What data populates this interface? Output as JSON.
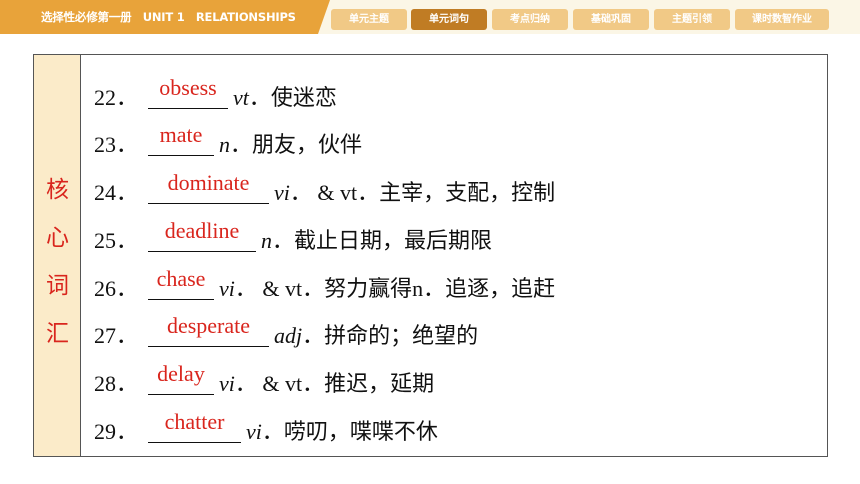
{
  "header": {
    "book_title": "选择性必修第一册　UNIT 1　RELATIONSHIPS",
    "tabs": [
      {
        "label": "单元主题",
        "active": false
      },
      {
        "label": "单元词句",
        "active": true
      },
      {
        "label": "考点归纳",
        "active": false
      },
      {
        "label": "基础巩固",
        "active": false
      },
      {
        "label": "主题引领",
        "active": false
      },
      {
        "label": "课时数智作业",
        "active": false
      }
    ]
  },
  "side_label": [
    "核",
    "心",
    "词",
    "汇"
  ],
  "vocab": [
    {
      "num": "22．",
      "answer": "obsess",
      "pos": "vt",
      "meaning": "．使迷恋"
    },
    {
      "num": "23．",
      "answer": "mate",
      "pos": "n",
      "meaning": "．朋友，伙伴"
    },
    {
      "num": "24．",
      "answer": "dominate",
      "pos": "vi",
      "meaning": "． & vt．主宰，支配，控制"
    },
    {
      "num": "25．",
      "answer": "deadline",
      "pos": "n",
      "meaning": "．截止日期，最后期限"
    },
    {
      "num": "26．",
      "answer": "chase",
      "pos": "vi",
      "meaning": "． & vt．努力赢得n．追逐，追赶"
    },
    {
      "num": "27．",
      "answer": "desperate",
      "pos": "adj",
      "meaning": "．拼命的；绝望的"
    },
    {
      "num": "28．",
      "answer": "delay",
      "pos": "vi",
      "meaning": "． & vt．推迟，延期"
    },
    {
      "num": "29．",
      "answer": "chatter",
      "pos": "vi",
      "meaning": "．唠叨，喋喋不休"
    }
  ],
  "colors": {
    "accent": "#e8a33a",
    "tab": "#f1c986",
    "tab_active": "#c07c24",
    "answer": "#d9251d",
    "side_bg": "#fbebc9"
  }
}
